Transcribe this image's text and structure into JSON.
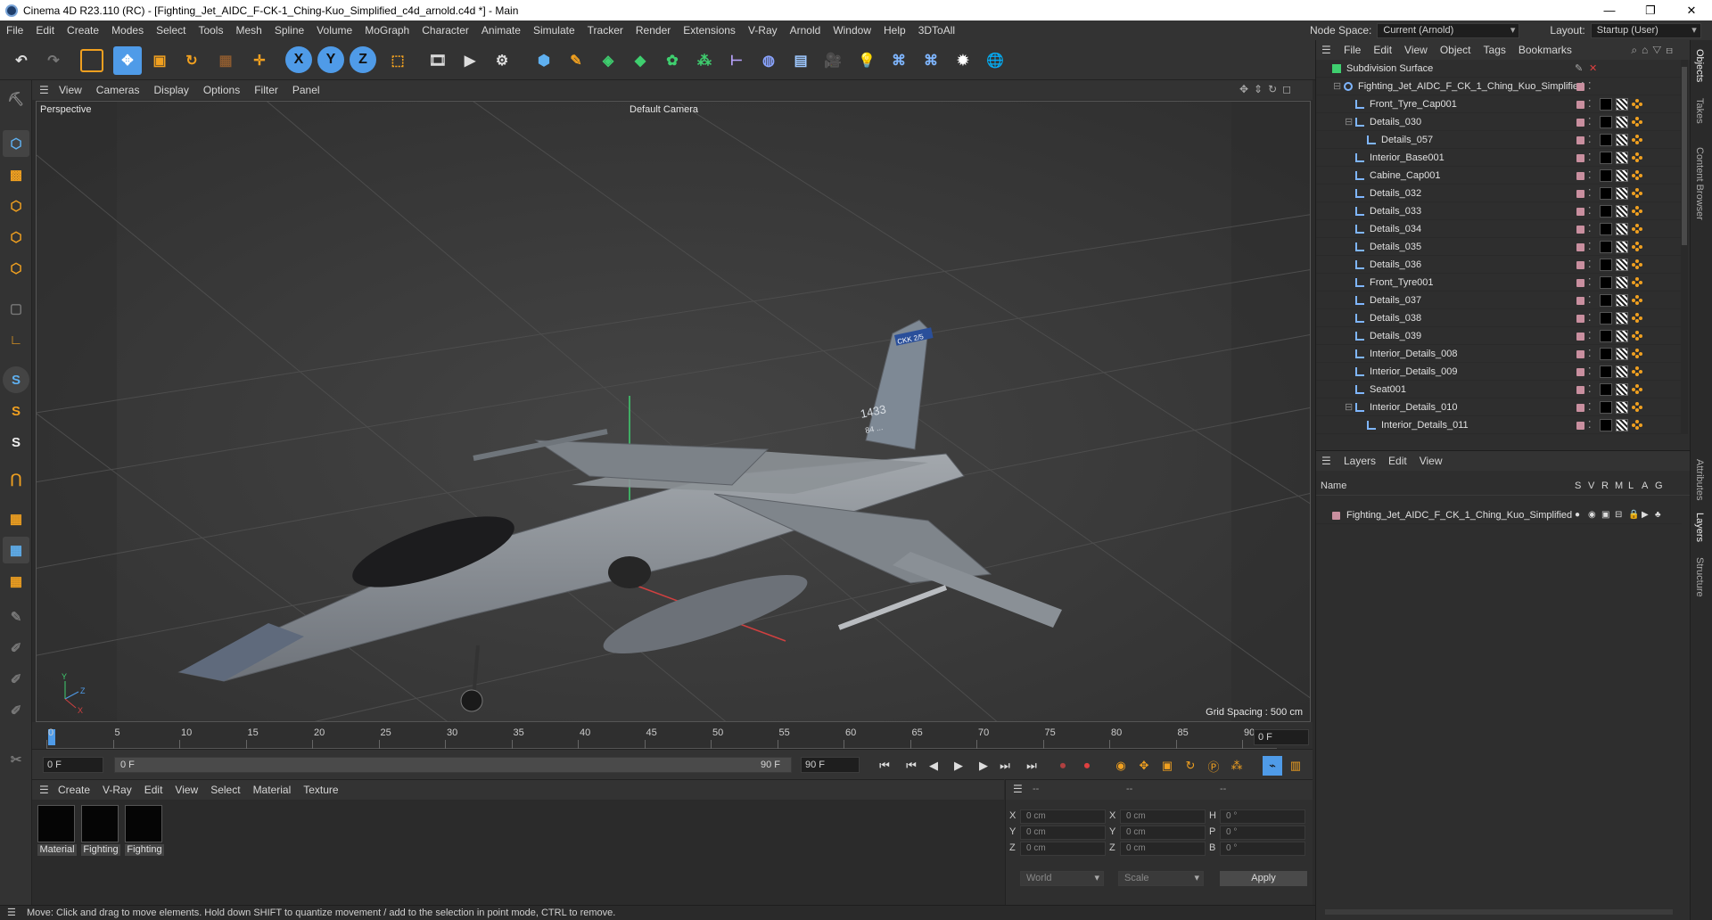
{
  "window": {
    "title": "Cinema 4D R23.110 (RC) - [Fighting_Jet_AIDC_F-CK-1_Ching-Kuo_Simplified_c4d_arnold.c4d *] - Main",
    "minimize": "—",
    "maximize": "❐",
    "close": "✕"
  },
  "menu": [
    "File",
    "Edit",
    "Create",
    "Modes",
    "Select",
    "Tools",
    "Mesh",
    "Spline",
    "Volume",
    "MoGraph",
    "Character",
    "Animate",
    "Simulate",
    "Tracker",
    "Render",
    "Extensions",
    "V-Ray",
    "Arnold",
    "Window",
    "Help",
    "3DToAll"
  ],
  "nodespace": {
    "label": "Node Space:",
    "value": "Current (Arnold)",
    "layout_label": "Layout:",
    "layout_value": "Startup (User)"
  },
  "viewport_menu": [
    "View",
    "Cameras",
    "Display",
    "Options",
    "Filter",
    "Panel"
  ],
  "viewport": {
    "view_name": "Perspective",
    "camera": "Default Camera",
    "grid_spacing": "Grid Spacing : 500 cm",
    "tail_number": "1433",
    "tail_code": "84 ...",
    "fin_text": "CKK 2/5"
  },
  "timeline": {
    "ticks": [
      "0",
      "5",
      "10",
      "15",
      "20",
      "25",
      "30",
      "35",
      "40",
      "45",
      "50",
      "55",
      "60",
      "65",
      "70",
      "75",
      "80",
      "85",
      "90"
    ],
    "current_frame": "0 F"
  },
  "playback": {
    "start": "0 F",
    "slider_start": "0 F",
    "slider_end": "90 F",
    "end": "90 F"
  },
  "material_menu": [
    "Create",
    "V-Ray",
    "Edit",
    "View",
    "Select",
    "Material",
    "Texture"
  ],
  "materials": [
    {
      "name": "Material"
    },
    {
      "name": "Fighting"
    },
    {
      "name": "Fighting"
    }
  ],
  "coords": {
    "headers": [
      "--",
      "--",
      "--"
    ],
    "rows": [
      {
        "a": "X",
        "av": "0 cm",
        "b": "X",
        "bv": "0 cm",
        "c": "H",
        "cv": "0 °"
      },
      {
        "a": "Y",
        "av": "0 cm",
        "b": "Y",
        "bv": "0 cm",
        "c": "P",
        "cv": "0 °"
      },
      {
        "a": "Z",
        "av": "0 cm",
        "b": "Z",
        "bv": "0 cm",
        "c": "B",
        "cv": "0 °"
      }
    ],
    "space": "World",
    "mode": "Scale",
    "apply": "Apply"
  },
  "status": "Move: Click and drag to move elements. Hold down SHIFT to quantize movement / add to the selection in point mode, CTRL to remove.",
  "object_menu": [
    "File",
    "Edit",
    "View",
    "Object",
    "Tags",
    "Bookmarks"
  ],
  "objects": [
    {
      "name": "Subdivision Surface",
      "indent": 0,
      "icon": "subdiv"
    },
    {
      "name": "Fighting_Jet_AIDC_F_CK_1_Ching_Kuo_Simplified",
      "indent": 1,
      "icon": "null"
    },
    {
      "name": "Front_Tyre_Cap001",
      "indent": 2,
      "icon": "poly"
    },
    {
      "name": "Details_030",
      "indent": 2,
      "icon": "poly"
    },
    {
      "name": "Details_057",
      "indent": 3,
      "icon": "poly"
    },
    {
      "name": "Interior_Base001",
      "indent": 2,
      "icon": "poly"
    },
    {
      "name": "Cabine_Cap001",
      "indent": 2,
      "icon": "poly"
    },
    {
      "name": "Details_032",
      "indent": 2,
      "icon": "poly"
    },
    {
      "name": "Details_033",
      "indent": 2,
      "icon": "poly"
    },
    {
      "name": "Details_034",
      "indent": 2,
      "icon": "poly"
    },
    {
      "name": "Details_035",
      "indent": 2,
      "icon": "poly"
    },
    {
      "name": "Details_036",
      "indent": 2,
      "icon": "poly"
    },
    {
      "name": "Front_Tyre001",
      "indent": 2,
      "icon": "poly"
    },
    {
      "name": "Details_037",
      "indent": 2,
      "icon": "poly"
    },
    {
      "name": "Details_038",
      "indent": 2,
      "icon": "poly"
    },
    {
      "name": "Details_039",
      "indent": 2,
      "icon": "poly"
    },
    {
      "name": "Interior_Details_008",
      "indent": 2,
      "icon": "poly"
    },
    {
      "name": "Interior_Details_009",
      "indent": 2,
      "icon": "poly"
    },
    {
      "name": "Seat001",
      "indent": 2,
      "icon": "poly"
    },
    {
      "name": "Interior_Details_010",
      "indent": 2,
      "icon": "poly"
    },
    {
      "name": "Interior_Details_011",
      "indent": 3,
      "icon": "poly"
    }
  ],
  "layers_menu": [
    "Layers",
    "Edit",
    "View"
  ],
  "layers_header": {
    "name": "Name",
    "cols": [
      "S",
      "V",
      "R",
      "M",
      "L",
      "A",
      "G"
    ]
  },
  "layers": [
    {
      "name": "Fighting_Jet_AIDC_F_CK_1_Ching_Kuo_Simplified"
    }
  ],
  "side_tabs": [
    "Objects",
    "Takes",
    "Content Browser",
    "Attributes",
    "Layers",
    "Structure"
  ],
  "colors": {
    "accent": "#4f9be8",
    "highlight": "#f0a020",
    "ui_bg": "#333333"
  }
}
